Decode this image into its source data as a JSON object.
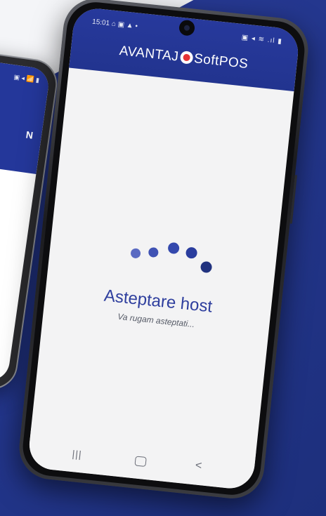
{
  "back_phone": {
    "status_icons": "▣ ◂ 📶 ▮",
    "visible_letter": "N"
  },
  "status_bar": {
    "time": "15:01",
    "left_icons": "⌂ ▣ ▲ •",
    "right_icons": "▣ ◂ ≋ .ıl ▮"
  },
  "app_header": {
    "brand_left": "AVANTAJ",
    "brand_right": "SoftPOS",
    "accent_color": "#e53235",
    "header_color": "#24379a"
  },
  "loading": {
    "title": "Asteptare host",
    "subtitle": "Va rugam asteptati..."
  },
  "nav_bar": {
    "recent_icon": "|||",
    "back_icon": "<"
  }
}
